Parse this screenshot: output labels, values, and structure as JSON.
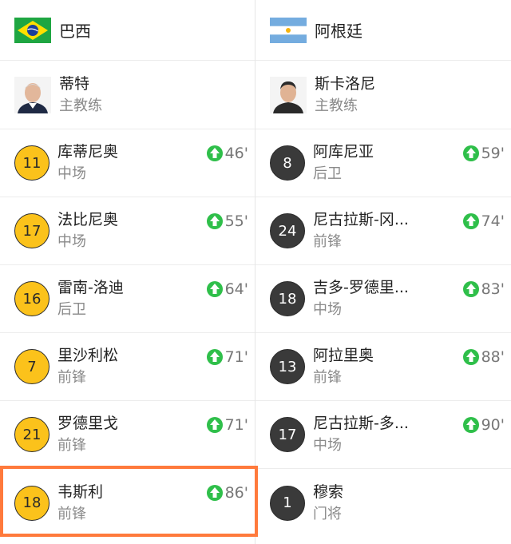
{
  "teams": [
    {
      "name": "巴西",
      "flag_icon": "brazil-flag-icon",
      "coach": {
        "name": "蒂特",
        "role": "主教练"
      },
      "players": [
        {
          "number": "11",
          "name": "库蒂尼奥",
          "position": "中场",
          "minute": "46'"
        },
        {
          "number": "17",
          "name": "法比尼奥",
          "position": "中场",
          "minute": "55'"
        },
        {
          "number": "16",
          "name": "雷南-洛迪",
          "position": "后卫",
          "minute": "64'"
        },
        {
          "number": "7",
          "name": "里沙利松",
          "position": "前锋",
          "minute": "71'"
        },
        {
          "number": "21",
          "name": "罗德里戈",
          "position": "前锋",
          "minute": "71'"
        },
        {
          "number": "18",
          "name": "韦斯利",
          "position": "前锋",
          "minute": "86'"
        }
      ]
    },
    {
      "name": "阿根廷",
      "flag_icon": "argentina-flag-icon",
      "coach": {
        "name": "斯卡洛尼",
        "role": "主教练"
      },
      "players": [
        {
          "number": "8",
          "name": "阿库尼亚",
          "position": "后卫",
          "minute": "59'"
        },
        {
          "number": "24",
          "name": "尼古拉斯-冈...",
          "position": "前锋",
          "minute": "74'"
        },
        {
          "number": "18",
          "name": "吉多-罗德里...",
          "position": "中场",
          "minute": "83'"
        },
        {
          "number": "13",
          "name": "阿拉里奥",
          "position": "前锋",
          "minute": "88'"
        },
        {
          "number": "17",
          "name": "尼古拉斯-多...",
          "position": "中场",
          "minute": "90'"
        },
        {
          "number": "1",
          "name": "穆索",
          "position": "门将",
          "minute": ""
        }
      ]
    }
  ],
  "colors": {
    "brazil_badge": "#fbc21b",
    "argentina_badge": "#3a3a3a",
    "sub_in_arrow": "#2fbf4a",
    "highlight": "#ff7a3c"
  }
}
